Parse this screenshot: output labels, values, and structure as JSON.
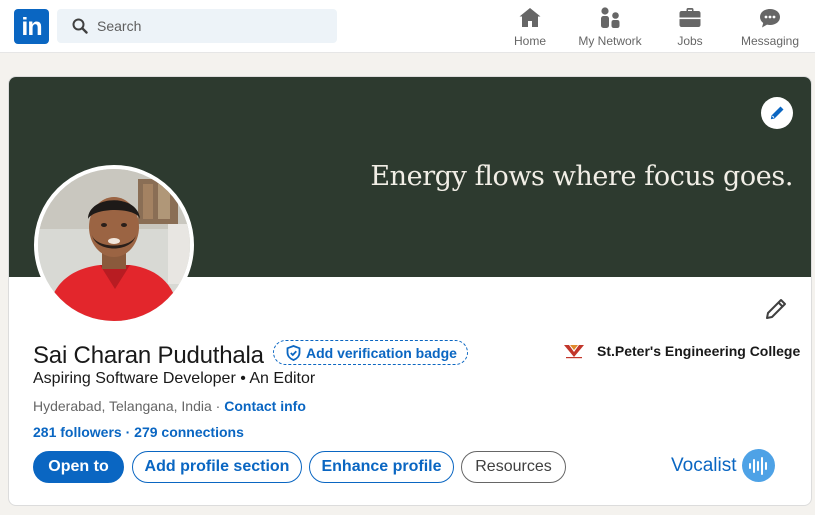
{
  "nav": {
    "logo_text": "in",
    "search_placeholder": "Search",
    "items": [
      {
        "label": "Home",
        "icon": "home-icon"
      },
      {
        "label": "My Network",
        "icon": "my-network-icon"
      },
      {
        "label": "Jobs",
        "icon": "briefcase-icon"
      },
      {
        "label": "Messaging",
        "icon": "messaging-icon"
      }
    ]
  },
  "banner": {
    "quote": "Energy flows where focus goes.",
    "background_color": "#2d3a2f"
  },
  "profile": {
    "name": "Sai Charan Puduthala",
    "verification_label": "Add verification badge",
    "headline": "Aspiring Software Developer • An Editor",
    "location": "Hyderabad, Telangana, India",
    "location_separator": " · ",
    "contact_label": "Contact info",
    "followers": "281 followers",
    "stats_separator": " · ",
    "connections": "279 connections",
    "education": "St.Peter's Engineering College"
  },
  "actions": {
    "open_to": "Open to",
    "add_section": "Add profile section",
    "enhance": "Enhance profile",
    "resources": "Resources"
  },
  "vocalist": {
    "label": "Vocalist"
  },
  "colors": {
    "brand": "#0a66c2",
    "page_bg": "#f4f2ee"
  }
}
